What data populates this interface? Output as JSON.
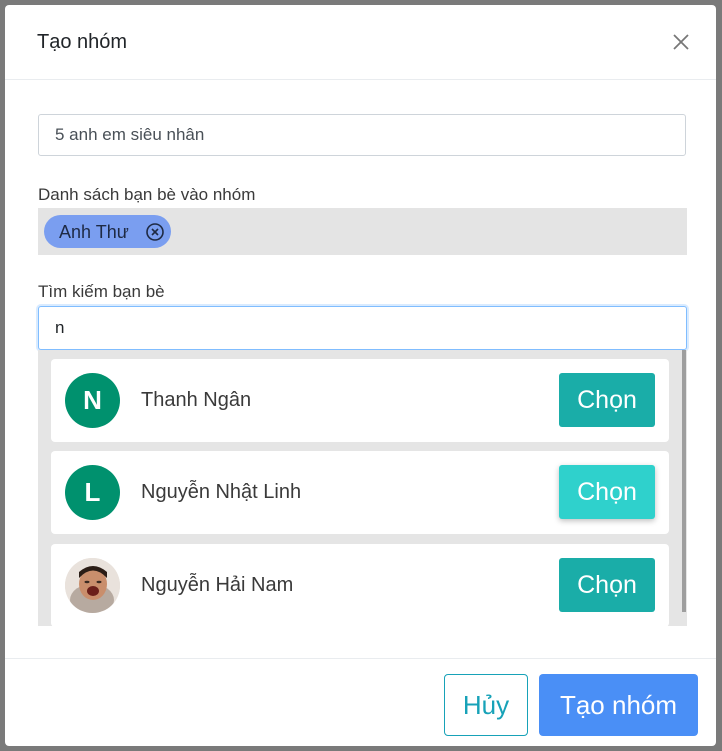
{
  "dialog": {
    "title": "Tạo nhóm",
    "close_icon": "close-icon"
  },
  "group_name": {
    "value": "5 anh em siêu nhân"
  },
  "members": {
    "label": "Danh sách bạn bè vào nhóm",
    "selected": [
      {
        "name": "Anh Thư",
        "remove_icon": "circle-x-icon",
        "color": "#7a9ef0"
      }
    ]
  },
  "search": {
    "label": "Tìm kiếm bạn bè",
    "value": "n"
  },
  "results": [
    {
      "initial": "N",
      "name": "Thanh Ngân",
      "button": "Chọn",
      "avatar_color": "#00916e"
    },
    {
      "initial": "L",
      "name": "Nguyễn Nhật Linh",
      "button": "Chọn",
      "avatar_color": "#00916e",
      "hovered": true
    },
    {
      "initial": "",
      "name": "Nguyễn Hải Nam",
      "button": "Chọn",
      "avatar": "photo"
    }
  ],
  "footer": {
    "cancel_label": "Hủy",
    "create_label": "Tạo nhóm"
  },
  "colors": {
    "accent_teal": "#1aada8",
    "primary_blue": "#4a8ff6",
    "chip_blue": "#7a9ef0"
  }
}
